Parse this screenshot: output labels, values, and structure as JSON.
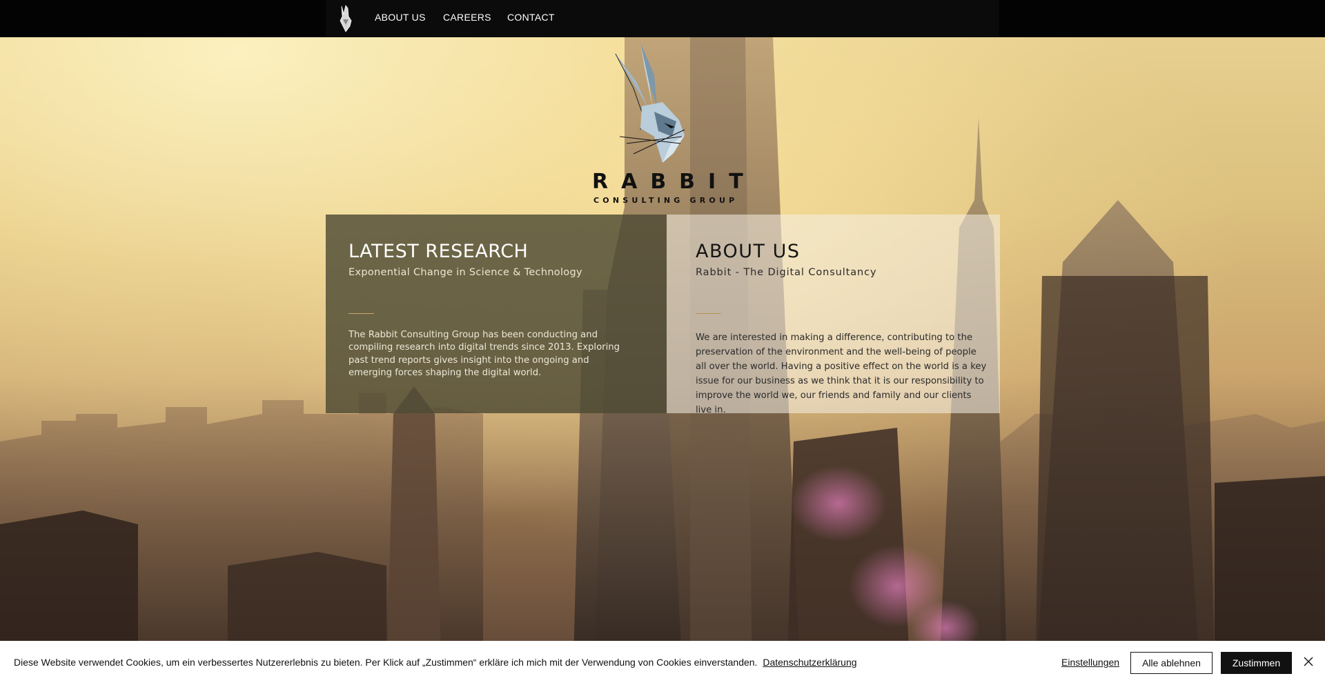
{
  "nav": {
    "logo_icon": "rabbit-logo-icon",
    "items": [
      {
        "label": "ABOUT US"
      },
      {
        "label": "CAREERS"
      },
      {
        "label": "CONTACT"
      }
    ]
  },
  "brand": {
    "logo_icon": "geometric-rabbit-icon",
    "name": "RABBIT",
    "tagline": "CONSULTING GROUP"
  },
  "panels": {
    "research": {
      "title": "LATEST RESEARCH",
      "subtitle": "Exponential Change in Science & Technology",
      "body": "The Rabbit Consulting Group has been conducting and compiling research into digital trends since 2013. Exploring past trend reports gives insight into the ongoing and emerging forces shaping the digital world."
    },
    "about": {
      "title": "ABOUT US",
      "subtitle": "Rabbit - The Digital Consultancy",
      "body": "We are interested in making a difference, contributing to the preservation of the environment and the well-being of people all over the world. Having a positive effect on the world is a key issue for our business as we think that it is our responsibility to improve the world we, our friends and family and our clients live in."
    }
  },
  "cookie": {
    "text": "Diese Website verwendet Cookies, um ein verbessertes Nutzererlebnis zu bieten. Per Klick auf „Zustimmen“ erkläre ich mich mit der Verwendung von Cookies einverstanden.",
    "privacy_link": "Datenschutzerklärung",
    "settings_label": "Einstellungen",
    "reject_label": "Alle ablehnen",
    "accept_label": "Zustimmen",
    "close_icon": "close-icon"
  },
  "colors": {
    "nav_bg": "#030303",
    "accent_rule": "#c7a96a",
    "research_panel": "#4e4a34",
    "accept_button": "#111111"
  }
}
